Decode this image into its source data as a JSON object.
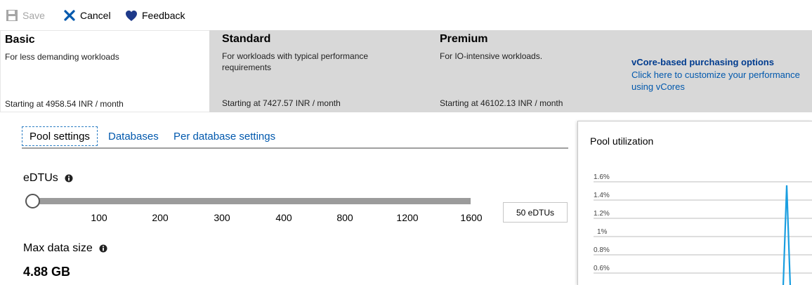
{
  "toolbar": {
    "save_label": "Save",
    "cancel_label": "Cancel",
    "feedback_label": "Feedback"
  },
  "tiers": {
    "basic": {
      "name": "Basic",
      "description": "For less demanding workloads",
      "price": "Starting at 4958.54 INR / month"
    },
    "standard": {
      "name": "Standard",
      "description": "For workloads with typical performance requirements",
      "price": "Starting at 7427.57 INR / month"
    },
    "premium": {
      "name": "Premium",
      "description": "For IO-intensive workloads.",
      "price": "Starting at 46102.13 INR / month"
    },
    "vcore": {
      "title": "vCore-based purchasing options",
      "description": "Click here to customize your performance using vCores"
    }
  },
  "tabs": {
    "pool_settings": "Pool settings",
    "databases": "Databases",
    "per_database_settings": "Per database settings"
  },
  "edtu": {
    "label": "eDTUs",
    "ticks": [
      "100",
      "200",
      "300",
      "400",
      "800",
      "1200",
      "1600"
    ],
    "value_display": "50 eDTUs"
  },
  "max_size": {
    "label": "Max data size",
    "value": "4.88 GB"
  },
  "pool_utilization": {
    "title": "Pool utilization",
    "y_ticks": [
      "1.6%",
      "1.4%",
      "1.2%",
      "1%",
      "0.8%",
      "0.6%"
    ]
  },
  "colors": {
    "link": "#0058ad",
    "link_bold": "#003c8f",
    "tier_bg": "#d8d8d8",
    "heart": "#1e3a8a",
    "chart_line": "#1a9ee0"
  },
  "icons": {
    "save": "save-icon",
    "cancel": "close-icon",
    "feedback": "heart-icon",
    "info": "info-icon"
  }
}
